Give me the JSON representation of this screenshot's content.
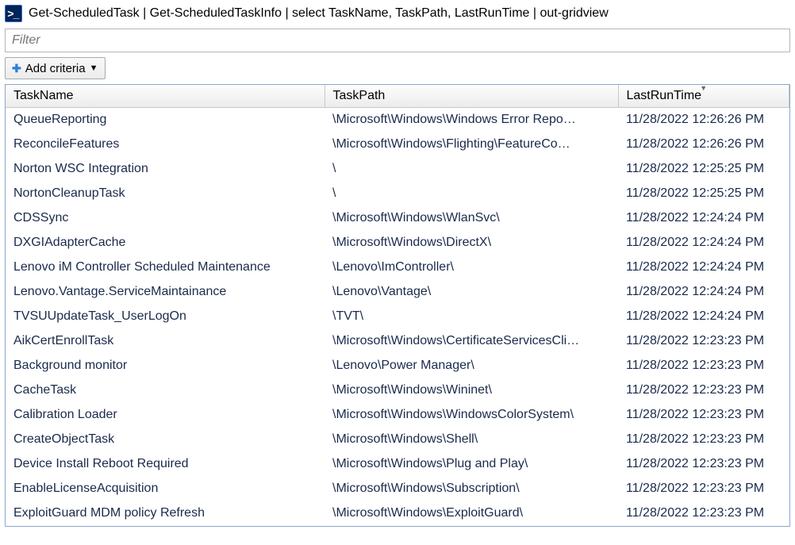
{
  "window": {
    "icon_label": ">_",
    "title": "Get-ScheduledTask | Get-ScheduledTaskInfo | select TaskName, TaskPath, LastRunTime | out-gridview"
  },
  "filter": {
    "placeholder": "Filter"
  },
  "toolbar": {
    "add_criteria_label": "Add criteria"
  },
  "columns": {
    "taskname": "TaskName",
    "taskpath": "TaskPath",
    "lastruntime": "LastRunTime"
  },
  "sort_column": "lastruntime",
  "sort_dir": "desc",
  "rows": [
    {
      "taskname": "QueueReporting",
      "taskpath": "\\Microsoft\\Windows\\Windows Error Repo…",
      "lastruntime": "11/28/2022 12:26:26 PM"
    },
    {
      "taskname": "ReconcileFeatures",
      "taskpath": "\\Microsoft\\Windows\\Flighting\\FeatureCo…",
      "lastruntime": "11/28/2022 12:26:26 PM"
    },
    {
      "taskname": "Norton WSC Integration",
      "taskpath": "\\",
      "lastruntime": "11/28/2022 12:25:25 PM"
    },
    {
      "taskname": "NortonCleanupTask",
      "taskpath": "\\",
      "lastruntime": "11/28/2022 12:25:25 PM"
    },
    {
      "taskname": "CDSSync",
      "taskpath": "\\Microsoft\\Windows\\WlanSvc\\",
      "lastruntime": "11/28/2022 12:24:24 PM"
    },
    {
      "taskname": "DXGIAdapterCache",
      "taskpath": "\\Microsoft\\Windows\\DirectX\\",
      "lastruntime": "11/28/2022 12:24:24 PM"
    },
    {
      "taskname": "Lenovo iM Controller Scheduled Maintenance",
      "taskpath": "\\Lenovo\\ImController\\",
      "lastruntime": "11/28/2022 12:24:24 PM"
    },
    {
      "taskname": "Lenovo.Vantage.ServiceMaintainance",
      "taskpath": "\\Lenovo\\Vantage\\",
      "lastruntime": "11/28/2022 12:24:24 PM"
    },
    {
      "taskname": "TVSUUpdateTask_UserLogOn",
      "taskpath": "\\TVT\\",
      "lastruntime": "11/28/2022 12:24:24 PM"
    },
    {
      "taskname": "AikCertEnrollTask",
      "taskpath": "\\Microsoft\\Windows\\CertificateServicesCli…",
      "lastruntime": "11/28/2022 12:23:23 PM"
    },
    {
      "taskname": "Background monitor",
      "taskpath": "\\Lenovo\\Power Manager\\",
      "lastruntime": "11/28/2022 12:23:23 PM"
    },
    {
      "taskname": "CacheTask",
      "taskpath": "\\Microsoft\\Windows\\Wininet\\",
      "lastruntime": "11/28/2022 12:23:23 PM"
    },
    {
      "taskname": "Calibration Loader",
      "taskpath": "\\Microsoft\\Windows\\WindowsColorSystem\\",
      "lastruntime": "11/28/2022 12:23:23 PM"
    },
    {
      "taskname": "CreateObjectTask",
      "taskpath": "\\Microsoft\\Windows\\Shell\\",
      "lastruntime": "11/28/2022 12:23:23 PM"
    },
    {
      "taskname": "Device Install Reboot Required",
      "taskpath": "\\Microsoft\\Windows\\Plug and Play\\",
      "lastruntime": "11/28/2022 12:23:23 PM"
    },
    {
      "taskname": "EnableLicenseAcquisition",
      "taskpath": "\\Microsoft\\Windows\\Subscription\\",
      "lastruntime": "11/28/2022 12:23:23 PM"
    },
    {
      "taskname": "ExploitGuard MDM policy Refresh",
      "taskpath": "\\Microsoft\\Windows\\ExploitGuard\\",
      "lastruntime": "11/28/2022 12:23:23 PM"
    }
  ]
}
